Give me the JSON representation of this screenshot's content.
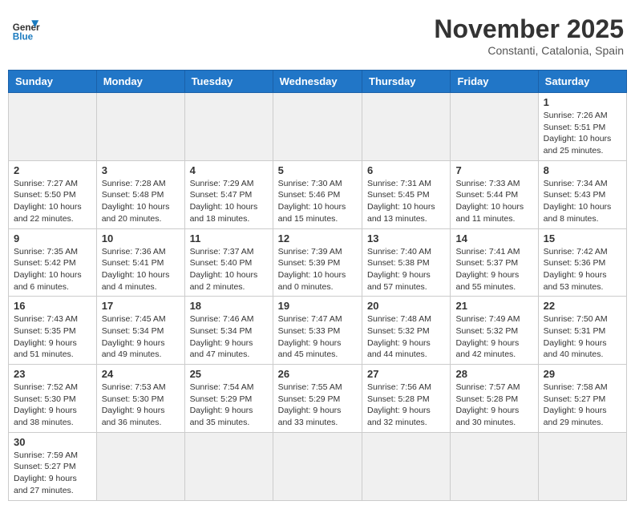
{
  "header": {
    "logo_general": "General",
    "logo_blue": "Blue",
    "month_title": "November 2025",
    "subtitle": "Constanti, Catalonia, Spain"
  },
  "days_of_week": [
    "Sunday",
    "Monday",
    "Tuesday",
    "Wednesday",
    "Thursday",
    "Friday",
    "Saturday"
  ],
  "weeks": [
    [
      {
        "day": null,
        "info": null
      },
      {
        "day": null,
        "info": null
      },
      {
        "day": null,
        "info": null
      },
      {
        "day": null,
        "info": null
      },
      {
        "day": null,
        "info": null
      },
      {
        "day": null,
        "info": null
      },
      {
        "day": "1",
        "info": "Sunrise: 7:26 AM\nSunset: 5:51 PM\nDaylight: 10 hours and 25 minutes."
      }
    ],
    [
      {
        "day": "2",
        "info": "Sunrise: 7:27 AM\nSunset: 5:50 PM\nDaylight: 10 hours and 22 minutes."
      },
      {
        "day": "3",
        "info": "Sunrise: 7:28 AM\nSunset: 5:48 PM\nDaylight: 10 hours and 20 minutes."
      },
      {
        "day": "4",
        "info": "Sunrise: 7:29 AM\nSunset: 5:47 PM\nDaylight: 10 hours and 18 minutes."
      },
      {
        "day": "5",
        "info": "Sunrise: 7:30 AM\nSunset: 5:46 PM\nDaylight: 10 hours and 15 minutes."
      },
      {
        "day": "6",
        "info": "Sunrise: 7:31 AM\nSunset: 5:45 PM\nDaylight: 10 hours and 13 minutes."
      },
      {
        "day": "7",
        "info": "Sunrise: 7:33 AM\nSunset: 5:44 PM\nDaylight: 10 hours and 11 minutes."
      },
      {
        "day": "8",
        "info": "Sunrise: 7:34 AM\nSunset: 5:43 PM\nDaylight: 10 hours and 8 minutes."
      }
    ],
    [
      {
        "day": "9",
        "info": "Sunrise: 7:35 AM\nSunset: 5:42 PM\nDaylight: 10 hours and 6 minutes."
      },
      {
        "day": "10",
        "info": "Sunrise: 7:36 AM\nSunset: 5:41 PM\nDaylight: 10 hours and 4 minutes."
      },
      {
        "day": "11",
        "info": "Sunrise: 7:37 AM\nSunset: 5:40 PM\nDaylight: 10 hours and 2 minutes."
      },
      {
        "day": "12",
        "info": "Sunrise: 7:39 AM\nSunset: 5:39 PM\nDaylight: 10 hours and 0 minutes."
      },
      {
        "day": "13",
        "info": "Sunrise: 7:40 AM\nSunset: 5:38 PM\nDaylight: 9 hours and 57 minutes."
      },
      {
        "day": "14",
        "info": "Sunrise: 7:41 AM\nSunset: 5:37 PM\nDaylight: 9 hours and 55 minutes."
      },
      {
        "day": "15",
        "info": "Sunrise: 7:42 AM\nSunset: 5:36 PM\nDaylight: 9 hours and 53 minutes."
      }
    ],
    [
      {
        "day": "16",
        "info": "Sunrise: 7:43 AM\nSunset: 5:35 PM\nDaylight: 9 hours and 51 minutes."
      },
      {
        "day": "17",
        "info": "Sunrise: 7:45 AM\nSunset: 5:34 PM\nDaylight: 9 hours and 49 minutes."
      },
      {
        "day": "18",
        "info": "Sunrise: 7:46 AM\nSunset: 5:34 PM\nDaylight: 9 hours and 47 minutes."
      },
      {
        "day": "19",
        "info": "Sunrise: 7:47 AM\nSunset: 5:33 PM\nDaylight: 9 hours and 45 minutes."
      },
      {
        "day": "20",
        "info": "Sunrise: 7:48 AM\nSunset: 5:32 PM\nDaylight: 9 hours and 44 minutes."
      },
      {
        "day": "21",
        "info": "Sunrise: 7:49 AM\nSunset: 5:32 PM\nDaylight: 9 hours and 42 minutes."
      },
      {
        "day": "22",
        "info": "Sunrise: 7:50 AM\nSunset: 5:31 PM\nDaylight: 9 hours and 40 minutes."
      }
    ],
    [
      {
        "day": "23",
        "info": "Sunrise: 7:52 AM\nSunset: 5:30 PM\nDaylight: 9 hours and 38 minutes."
      },
      {
        "day": "24",
        "info": "Sunrise: 7:53 AM\nSunset: 5:30 PM\nDaylight: 9 hours and 36 minutes."
      },
      {
        "day": "25",
        "info": "Sunrise: 7:54 AM\nSunset: 5:29 PM\nDaylight: 9 hours and 35 minutes."
      },
      {
        "day": "26",
        "info": "Sunrise: 7:55 AM\nSunset: 5:29 PM\nDaylight: 9 hours and 33 minutes."
      },
      {
        "day": "27",
        "info": "Sunrise: 7:56 AM\nSunset: 5:28 PM\nDaylight: 9 hours and 32 minutes."
      },
      {
        "day": "28",
        "info": "Sunrise: 7:57 AM\nSunset: 5:28 PM\nDaylight: 9 hours and 30 minutes."
      },
      {
        "day": "29",
        "info": "Sunrise: 7:58 AM\nSunset: 5:27 PM\nDaylight: 9 hours and 29 minutes."
      }
    ],
    [
      {
        "day": "30",
        "info": "Sunrise: 7:59 AM\nSunset: 5:27 PM\nDaylight: 9 hours and 27 minutes."
      },
      {
        "day": null,
        "info": null
      },
      {
        "day": null,
        "info": null
      },
      {
        "day": null,
        "info": null
      },
      {
        "day": null,
        "info": null
      },
      {
        "day": null,
        "info": null
      },
      {
        "day": null,
        "info": null
      }
    ]
  ]
}
